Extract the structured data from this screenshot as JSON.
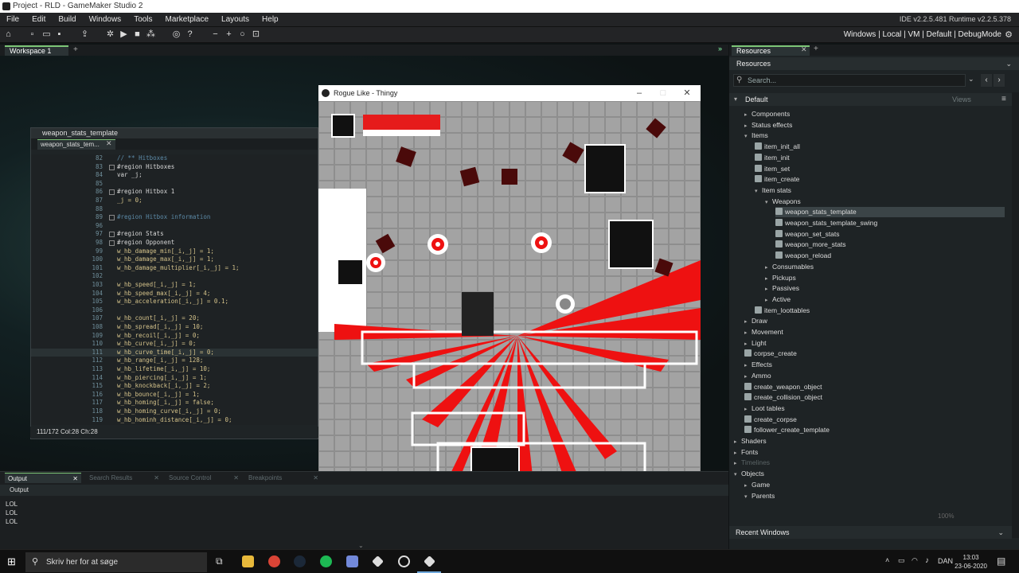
{
  "window_title": "Project - RLD - GameMaker Studio 2",
  "menu": [
    "File",
    "Edit",
    "Build",
    "Windows",
    "Tools",
    "Marketplace",
    "Layouts",
    "Help"
  ],
  "versions": "IDE v2.2.5.481  Runtime v2.2.5.378",
  "targets": "Windows | Local | VM | Default | DebugMode",
  "workspace_tab": "Workspace 1",
  "code_window": {
    "title": "weapon_stats_template",
    "tab": "weapon_stats_tem...",
    "status": "111/172 Col:28 Ch:28",
    "lines": [
      {
        "n": "82",
        "t": "// ** Hitboxes",
        "cls": "cm"
      },
      {
        "n": "83",
        "t": "#region Hitboxes",
        "cls": "kw",
        "fold": true
      },
      {
        "n": "84",
        "t": "var _j;",
        "cls": "kw"
      },
      {
        "n": "85",
        "t": "",
        "cls": ""
      },
      {
        "n": "86",
        "t": "#region Hitbox 1",
        "cls": "kw",
        "fold": true
      },
      {
        "n": "87",
        "t": "_j = 0;",
        "cls": ""
      },
      {
        "n": "88",
        "t": "",
        "cls": ""
      },
      {
        "n": "89",
        "t": "#region Hitbox information",
        "cls": "cm",
        "fold": true
      },
      {
        "n": "96",
        "t": "",
        "cls": ""
      },
      {
        "n": "97",
        "t": "#region Stats",
        "cls": "kw",
        "fold": true
      },
      {
        "n": "98",
        "t": "#region Opponent",
        "cls": "kw",
        "fold": true
      },
      {
        "n": "99",
        "t": "w_hb_damage_min[_i,_j] = 1;",
        "cls": ""
      },
      {
        "n": "100",
        "t": "w_hb_damage_max[_i,_j] = 1;",
        "cls": ""
      },
      {
        "n": "101",
        "t": "w_hb_damage_multiplier[_i,_j] = 1;",
        "cls": ""
      },
      {
        "n": "102",
        "t": "",
        "cls": ""
      },
      {
        "n": "103",
        "t": "w_hb_speed[_i,_j] = 1;",
        "cls": ""
      },
      {
        "n": "104",
        "t": "w_hb_speed_max[_i,_j] = 4;",
        "cls": ""
      },
      {
        "n": "105",
        "t": "w_hb_acceleration[_i,_j] = 0.1;",
        "cls": ""
      },
      {
        "n": "106",
        "t": "",
        "cls": ""
      },
      {
        "n": "107",
        "t": "w_hb_count[_i,_j] = 20;",
        "cls": ""
      },
      {
        "n": "108",
        "t": "w_hb_spread[_i,_j] = 10;",
        "cls": ""
      },
      {
        "n": "109",
        "t": "w_hb_recoil[_i,_j] = 0;",
        "cls": ""
      },
      {
        "n": "110",
        "t": "w_hb_curve[_i,_j] = 0;",
        "cls": ""
      },
      {
        "n": "111",
        "t": "w_hb_curve_time[_i,_j] = 0;",
        "cls": "hl"
      },
      {
        "n": "112",
        "t": "w_hb_range[_i,_j] = 128;",
        "cls": ""
      },
      {
        "n": "113",
        "t": "w_hb_lifetime[_i,_j] = 10;",
        "cls": ""
      },
      {
        "n": "114",
        "t": "w_hb_piercing[_i,_j] = 1;",
        "cls": ""
      },
      {
        "n": "115",
        "t": "w_hb_knockback[_i,_j] = 2;",
        "cls": ""
      },
      {
        "n": "116",
        "t": "w_hb_bounce[_i,_j] = 1;",
        "cls": ""
      },
      {
        "n": "117",
        "t": "w_hb_homing[_i,_j] = false;",
        "cls": ""
      },
      {
        "n": "118",
        "t": "w_hb_homing_curve[_i,_j] = 0;",
        "cls": ""
      },
      {
        "n": "119",
        "t": "w_hb_hominh_distance[_i,_j] = 0;",
        "cls": ""
      }
    ]
  },
  "game_window": {
    "title": "Rogue Like - Thingy",
    "health_fraction": 1.0
  },
  "output": {
    "tabs": [
      "Output",
      "Search Results",
      "Source Control",
      "Breakpoints"
    ],
    "header": "Output",
    "lines": [
      "LOL",
      "LOL",
      "LOL"
    ]
  },
  "resources": {
    "tab": "Resources",
    "header": "Resources",
    "search_placeholder": "Search...",
    "group": "Default",
    "views": "Views",
    "zoom": "100%",
    "recent": "Recent Windows",
    "tree": [
      {
        "label": "Components",
        "depth": 1,
        "arrow": "▸"
      },
      {
        "label": "Status effects",
        "depth": 1,
        "arrow": "▸"
      },
      {
        "label": "Items",
        "depth": 1,
        "arrow": "▾"
      },
      {
        "label": "item_init_all",
        "depth": 2,
        "script": true
      },
      {
        "label": "item_init",
        "depth": 2,
        "script": true
      },
      {
        "label": "item_set",
        "depth": 2,
        "script": true
      },
      {
        "label": "item_create",
        "depth": 2,
        "script": true
      },
      {
        "label": "Item stats",
        "depth": 2,
        "arrow": "▾"
      },
      {
        "label": "Weapons",
        "depth": 3,
        "arrow": "▾"
      },
      {
        "label": "weapon_stats_template",
        "depth": 4,
        "script": true,
        "sel": true
      },
      {
        "label": "weapon_stats_template_swing",
        "depth": 4,
        "script": true
      },
      {
        "label": "weapon_set_stats",
        "depth": 4,
        "script": true
      },
      {
        "label": "weapon_more_stats",
        "depth": 4,
        "script": true
      },
      {
        "label": "weapon_reload",
        "depth": 4,
        "script": true
      },
      {
        "label": "Consumables",
        "depth": 3,
        "arrow": "▸"
      },
      {
        "label": "Pickups",
        "depth": 3,
        "arrow": "▸"
      },
      {
        "label": "Passives",
        "depth": 3,
        "arrow": "▸"
      },
      {
        "label": "Active",
        "depth": 3,
        "arrow": "▸"
      },
      {
        "label": "item_loottables",
        "depth": 2,
        "script": true
      },
      {
        "label": "Draw",
        "depth": 1,
        "arrow": "▸"
      },
      {
        "label": "Movement",
        "depth": 1,
        "arrow": "▸"
      },
      {
        "label": "Light",
        "depth": 1,
        "arrow": "▸"
      },
      {
        "label": "corpse_create",
        "depth": 1,
        "script": true
      },
      {
        "label": "Effects",
        "depth": 1,
        "arrow": "▸"
      },
      {
        "label": "Ammo",
        "depth": 1,
        "arrow": "▸"
      },
      {
        "label": "create_weapon_object",
        "depth": 1,
        "script": true
      },
      {
        "label": "create_collision_object",
        "depth": 1,
        "script": true
      },
      {
        "label": "Loot tables",
        "depth": 1,
        "arrow": "▸"
      },
      {
        "label": "create_corpse",
        "depth": 1,
        "script": true
      },
      {
        "label": "follower_create_template",
        "depth": 1,
        "script": true
      },
      {
        "label": "Shaders",
        "depth": 0,
        "arrow": "▸"
      },
      {
        "label": "Fonts",
        "depth": 0,
        "arrow": "▸"
      },
      {
        "label": "Timelines",
        "depth": 0,
        "arrow": "▸",
        "dim": true
      },
      {
        "label": "Objects",
        "depth": 0,
        "arrow": "▾"
      },
      {
        "label": "Game",
        "depth": 1,
        "arrow": "▸"
      },
      {
        "label": "Parents",
        "depth": 1,
        "arrow": "▾"
      }
    ]
  },
  "taskbar": {
    "search_placeholder": "Skriv her for at søge",
    "lang": "DAN",
    "time": "13:03",
    "date": "23-06-2020"
  }
}
